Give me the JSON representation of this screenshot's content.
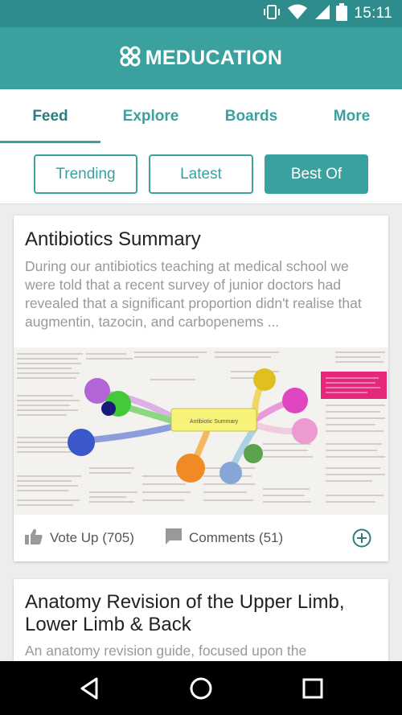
{
  "status_bar": {
    "time": "15:11"
  },
  "app": {
    "title": "MEDUCATION"
  },
  "tabs": [
    {
      "label": "Feed"
    },
    {
      "label": "Explore"
    },
    {
      "label": "Boards"
    },
    {
      "label": "More"
    }
  ],
  "filters": [
    {
      "label": "Trending"
    },
    {
      "label": "Latest"
    },
    {
      "label": "Best Of"
    }
  ],
  "posts": [
    {
      "title": "Antibiotics Summary",
      "excerpt": "During our antibiotics teaching at medical school we were told that a recent survey of junior doctors had revealed that a significant proportion didn't realise that augmentin, tazocin, and carbopenems ...",
      "image_label": "Antibiotic Summary",
      "vote_label": "Vote Up (705)",
      "comments_label": "Comments (51)"
    },
    {
      "title": "Anatomy Revision of the Upper Limb, Lower Limb & Back",
      "excerpt": "An anatomy revision guide, focused upon the"
    }
  ],
  "colors": {
    "primary": "#3aa19f",
    "status_bar": "#2e8c8c"
  },
  "icons": {
    "logo": "meducation-logo-icon",
    "vote": "thumbs-up-icon",
    "comments": "comment-icon",
    "add": "plus-circle-icon"
  }
}
